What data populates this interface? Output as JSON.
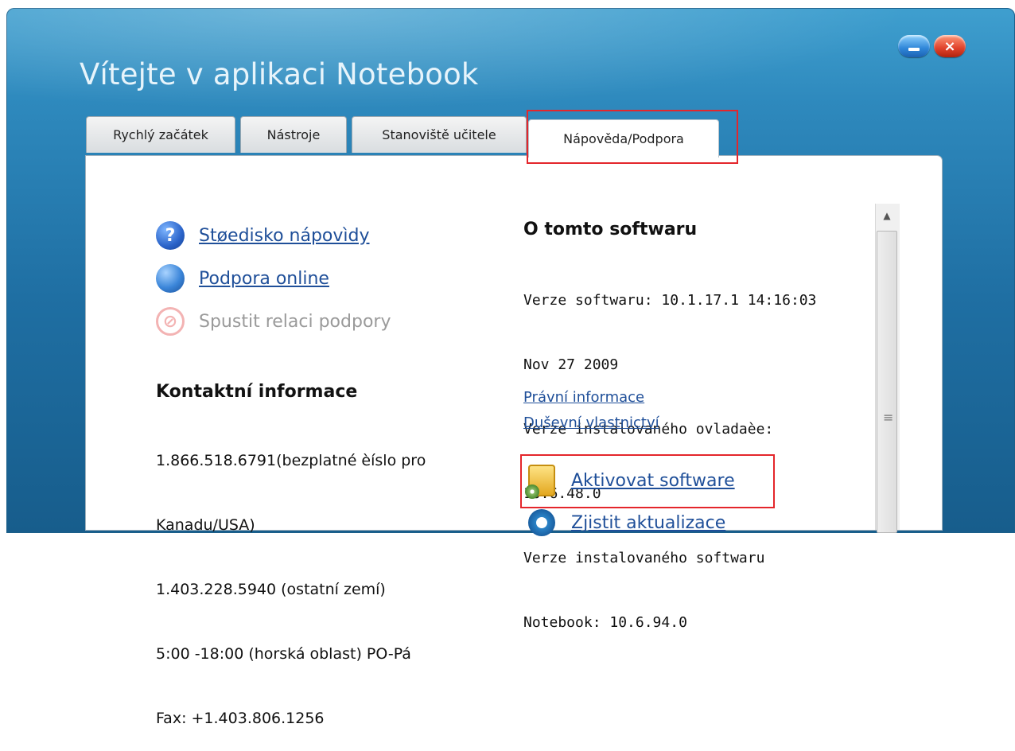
{
  "window": {
    "title": "Vítejte v aplikaci Notebook",
    "minimize_icon": "minimize-icon",
    "close_glyph": "×"
  },
  "tabs": [
    {
      "label": "Rychlý začátek",
      "active": false
    },
    {
      "label": "Nástroje",
      "active": false
    },
    {
      "label": "Stanoviště učitele",
      "active": false
    },
    {
      "label": "Nápověda/Podpora",
      "active": true
    }
  ],
  "help_links": [
    {
      "label": "Støedisko nápovìdy",
      "icon": "help-icon",
      "glyph": "?",
      "enabled": true
    },
    {
      "label": "Podpora online",
      "icon": "globe-icon",
      "glyph": "",
      "enabled": true
    },
    {
      "label": "Spustit relaci podpory",
      "icon": "blocked-icon",
      "glyph": "⊘",
      "enabled": false
    }
  ],
  "contact": {
    "heading": "Kontaktní informace",
    "lines": [
      "1.866.518.6791(bezplatné èíslo pro",
      "Kanadu/USA)",
      "1.403.228.5940 (ostatní zemí)",
      "5:00 -18:00 (horská oblast) PO-Pá",
      "Fax: +1.403.806.1256"
    ]
  },
  "about": {
    "heading": "O tomto softwaru",
    "lines": [
      "Verze softwaru: 10.1.17.1 14:16:03",
      "Nov 27 2009",
      "Verze instalovaného ovladaèe:",
      "10.6.48.0",
      "Verze instalovaného softwaru",
      "Notebook: 10.6.94.0"
    ],
    "legal_link": "Právní informace",
    "ip_link": "Duševní vlastnictví"
  },
  "actions": {
    "activate_label": "Aktivovat software",
    "activate_icon": "activate-software-icon",
    "update_label": "Zjistit aktualizace",
    "update_icon": "check-updates-icon"
  },
  "scrollbar": {
    "up_arrow": "▲",
    "grip": "≡"
  },
  "colors": {
    "highlight": "#e4262b",
    "link": "#1f4f99",
    "window_blue": "#2e89bd"
  }
}
